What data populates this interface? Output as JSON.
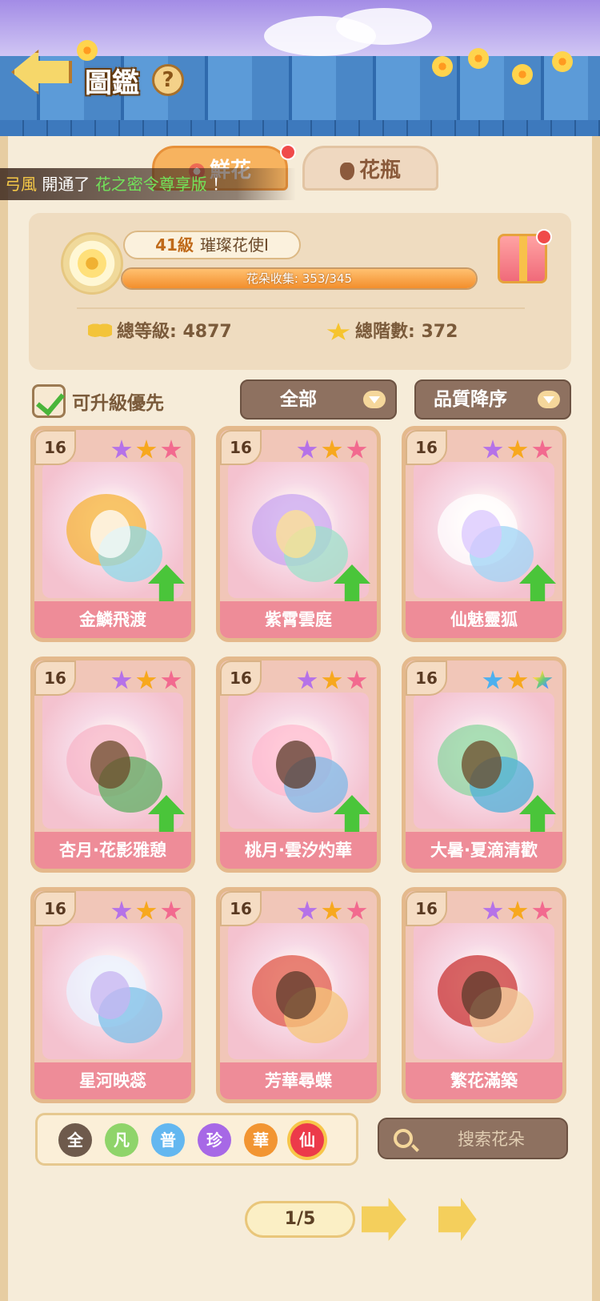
{
  "header": {
    "title": "圖鑑",
    "help_icon": "?"
  },
  "tabs": [
    {
      "label": "鮮花",
      "active": true,
      "has_notification": true
    },
    {
      "label": "花瓶",
      "active": false
    }
  ],
  "marquee": {
    "name": "弓風",
    "text_before": "開通了",
    "highlight": "花之密令尊享版",
    "text_after": "！"
  },
  "stats": {
    "level": "41級",
    "title": "璀璨花使I",
    "collection_label": "花朵收集: 353/345",
    "collection_current": 353,
    "collection_total": 345,
    "total_level_label": "總等級: 4877",
    "total_tier_label": "總階數: 372"
  },
  "filters": {
    "upgrade_first_label": "可升級優先",
    "upgrade_first_checked": true,
    "category": "全部",
    "sort": "品質降序"
  },
  "cards": [
    {
      "name": "金鱗飛渡",
      "level": "16",
      "stars": [
        "purple",
        "orange",
        "pink"
      ],
      "upgradable": true
    },
    {
      "name": "紫霄雲庭",
      "level": "16",
      "stars": [
        "purple",
        "orange",
        "pink"
      ],
      "upgradable": true
    },
    {
      "name": "仙魅靈狐",
      "level": "16",
      "stars": [
        "purple",
        "orange",
        "pink"
      ],
      "upgradable": true
    },
    {
      "name": "杏月·花影雅憩",
      "level": "16",
      "stars": [
        "purple",
        "orange",
        "pink"
      ],
      "upgradable": true
    },
    {
      "name": "桃月·雲汐灼華",
      "level": "16",
      "stars": [
        "purple",
        "orange",
        "pink"
      ],
      "upgradable": true
    },
    {
      "name": "大暑·夏滴清歡",
      "level": "16",
      "stars": [
        "blue",
        "orange",
        "rainbow"
      ],
      "upgradable": true
    },
    {
      "name": "星河映蕊",
      "level": "16",
      "stars": [
        "purple",
        "orange",
        "pink"
      ],
      "upgradable": false
    },
    {
      "name": "芳華尋蝶",
      "level": "16",
      "stars": [
        "purple",
        "orange",
        "pink"
      ],
      "upgradable": false
    },
    {
      "name": "繁花滿築",
      "level": "16",
      "stars": [
        "purple",
        "orange",
        "pink"
      ],
      "upgradable": false
    }
  ],
  "rarity_filters": [
    {
      "label": "全",
      "color": "#6e5a4c"
    },
    {
      "label": "凡",
      "color": "#8fd46a"
    },
    {
      "label": "普",
      "color": "#63b7f0"
    },
    {
      "label": "珍",
      "color": "#a768e6"
    },
    {
      "label": "華",
      "color": "#f29532"
    },
    {
      "label": "仙",
      "color": "#ec3a4a"
    }
  ],
  "search": {
    "placeholder": "搜索花朵"
  },
  "pagination": {
    "label": "1/5"
  },
  "colors": {
    "card_label_bg": "#ee8c98",
    "upgrade_arrow": "#4ac53a",
    "panel_bg": "#efdcc0"
  }
}
